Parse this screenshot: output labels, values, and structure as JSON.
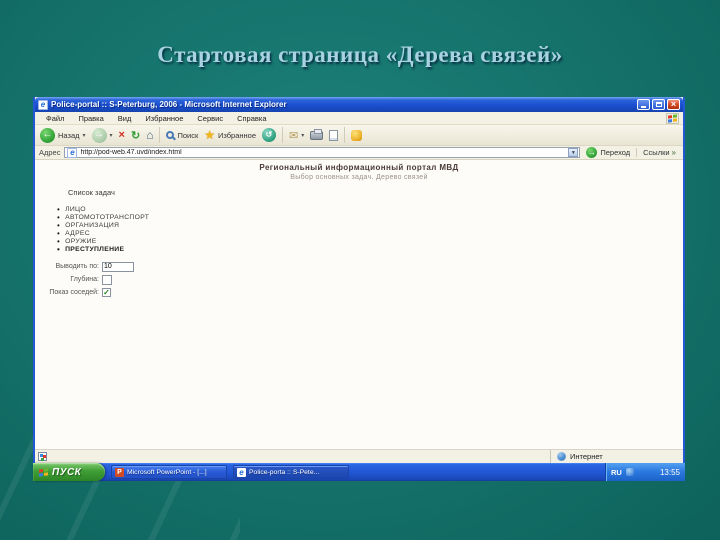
{
  "slide": {
    "title": "Стартовая страница «Дерева связей»"
  },
  "browser": {
    "title": "Police-portal :: S-Peterburg, 2006 - Microsoft Internet Explorer",
    "menu": [
      "Файл",
      "Правка",
      "Вид",
      "Избранное",
      "Сервис",
      "Справка"
    ],
    "toolbar": {
      "back": "Назад",
      "search": "Поиск",
      "favorites": "Избранное"
    },
    "address": {
      "label": "Адрес",
      "url": "http://pod-web.47.uvd/index.html",
      "go": "Переход",
      "links": "Ссылки",
      "links_chevron": "»"
    },
    "page": {
      "heading": "Региональный информационный портал МВД",
      "subheading": "Выбор основных задач. Дерево связей",
      "list_title": "Список задач",
      "links": [
        "ЛИЦО",
        "АВТОМОТОТРАНСПОРТ",
        "ОРГАНИЗАЦИЯ",
        "АДРЕС",
        "ОРУЖИЕ",
        "ПРЕСТУПЛЕНИЕ"
      ],
      "form": {
        "rows": [
          {
            "label": "Выводить по:",
            "value": "10"
          },
          {
            "label": "Глубина:",
            "value": ""
          },
          {
            "label": "Показ соседей:",
            "checkmark": "✓"
          }
        ]
      }
    },
    "statusbar": {
      "zone": "Интернет"
    }
  },
  "taskbar": {
    "start": "ПУСК",
    "tasks": [
      {
        "label": "Microsoft PowerPoint - [...]"
      },
      {
        "label": "Police-porta :: S-Pete..."
      }
    ],
    "tray": {
      "lang": "RU",
      "time": "13:55"
    }
  },
  "colors": {
    "slide_teal": "#15736c",
    "xp_blue": "#2257d6",
    "start_green": "#3f9e35"
  }
}
